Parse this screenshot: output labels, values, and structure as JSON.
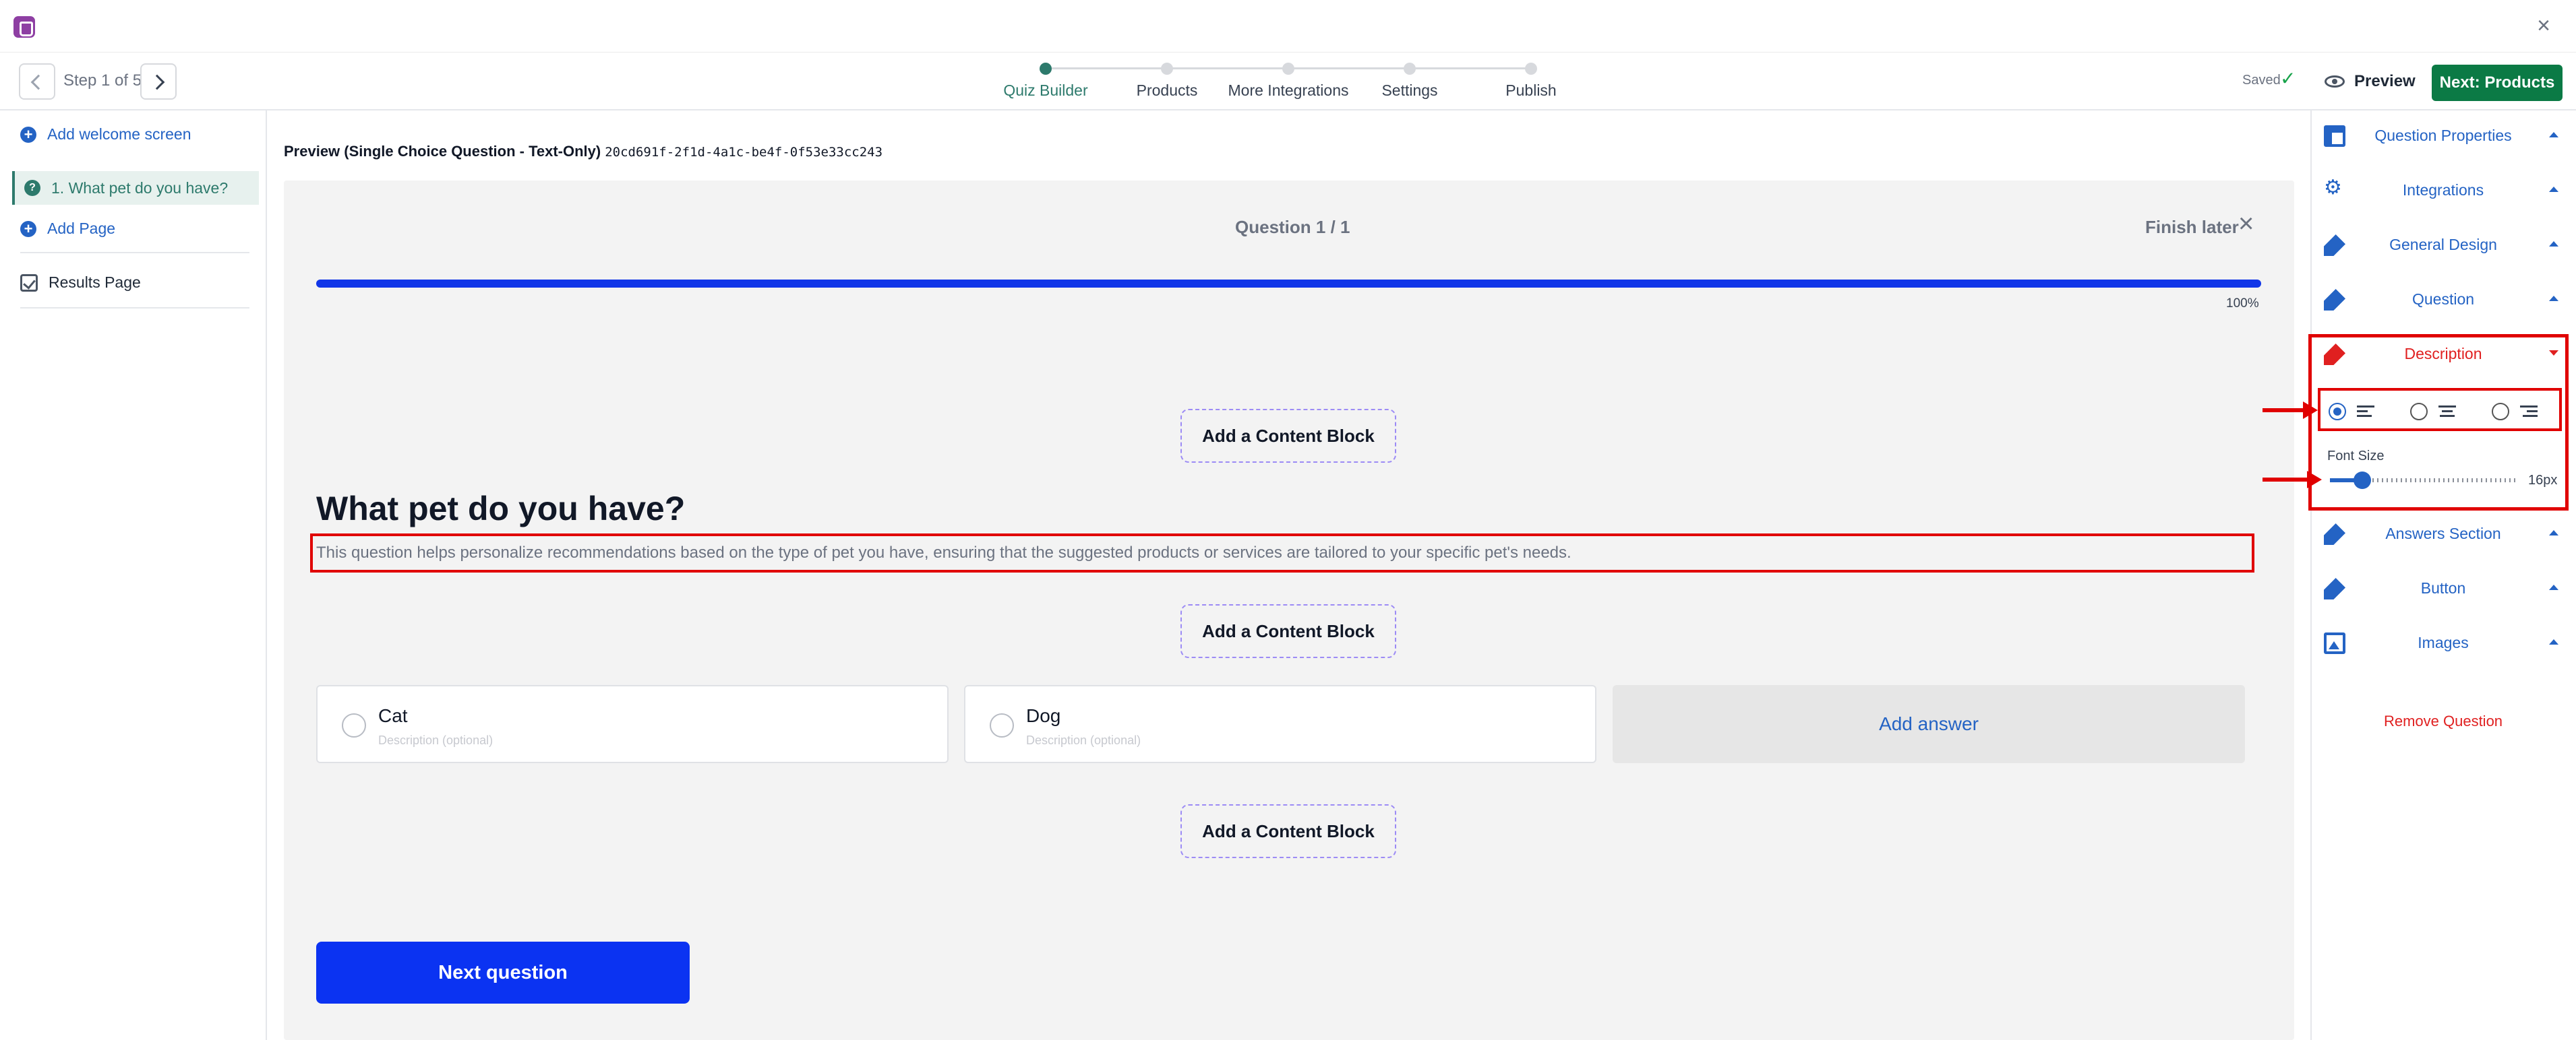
{
  "window": {
    "close_glyph": "×"
  },
  "header": {
    "step_indicator": "Step 1 of 5",
    "steps": [
      {
        "label": "Quiz Builder",
        "active": true
      },
      {
        "label": "Products",
        "active": false
      },
      {
        "label": "More Integrations",
        "active": false
      },
      {
        "label": "Settings",
        "active": false
      },
      {
        "label": "Publish",
        "active": false
      }
    ],
    "saved_label": "Saved",
    "saved_check": "✓",
    "preview_label": "Preview",
    "next_label": "Next: Products"
  },
  "sidebar": {
    "add_welcome": "Add welcome screen",
    "question_item": "1. What pet do you have?",
    "add_page": "Add Page",
    "results_page": "Results Page"
  },
  "main": {
    "preview_title": "Preview (Single Choice Question - Text-Only)",
    "question_id": "20cd691f-2f1d-4a1c-be4f-0f53e33cc243",
    "question_counter": "Question 1 / 1",
    "finish_later": "Finish later",
    "progress_percent": 100,
    "progress_label": "100%",
    "content_block_label": "Add a Content Block",
    "question_title": "What pet do you have?",
    "question_description": "This question helps personalize recommendations based on the type of pet you have, ensuring that the suggested products or services are tailored to your specific pet's needs.",
    "answers": [
      {
        "label": "Cat",
        "description_placeholder": "Description (optional)"
      },
      {
        "label": "Dog",
        "description_placeholder": "Description (optional)"
      }
    ],
    "add_answer": "Add answer",
    "next_question": "Next question"
  },
  "right_panel": {
    "sections": {
      "question_properties": "Question Properties",
      "integrations": "Integrations",
      "general_design": "General Design",
      "question": "Question",
      "description": "Description",
      "answers_section": "Answers Section",
      "button": "Button",
      "images": "Images"
    },
    "alignment_selected": "left",
    "font_size_label": "Font Size",
    "font_size_value": "16px",
    "font_size_fraction": 0.17,
    "remove_question": "Remove Question"
  },
  "colors": {
    "accent_teal": "#2d7a6c",
    "link_blue": "#2463c4",
    "primary_button": "#0b33f2",
    "next_products_green": "#0b7a45",
    "highlight_red": "#e00000"
  }
}
